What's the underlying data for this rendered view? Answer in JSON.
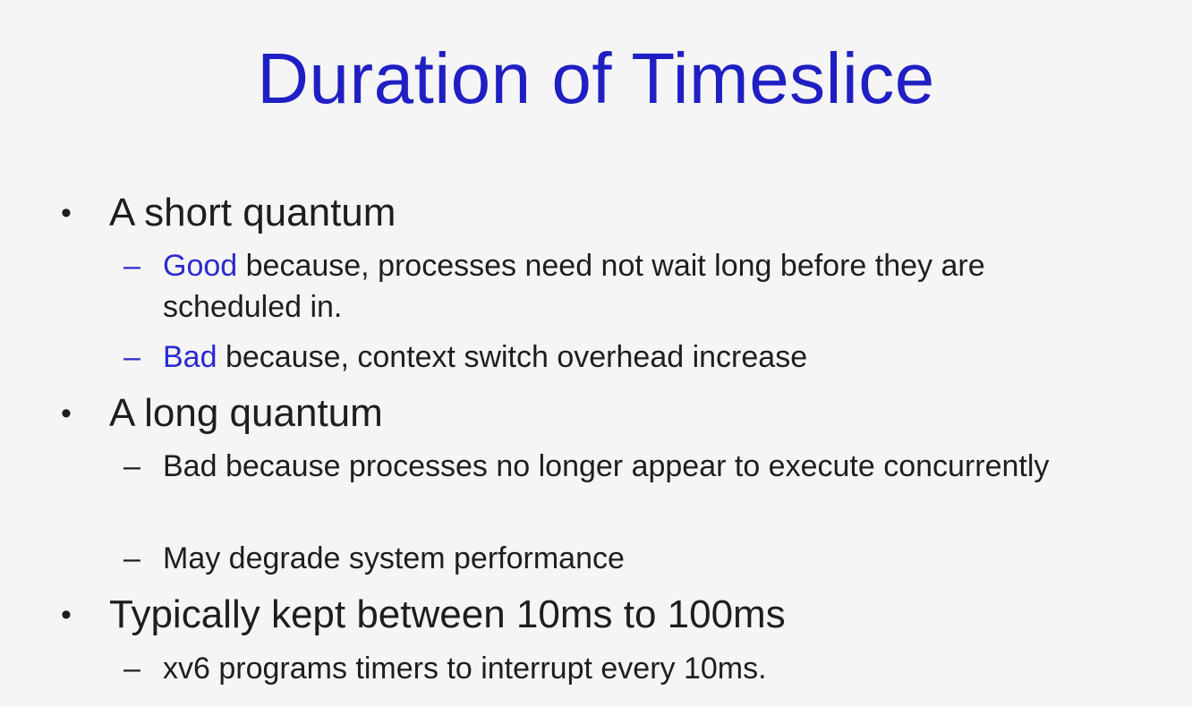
{
  "slide": {
    "title": "Duration of Timeslice",
    "bullet_glyph": "•",
    "dash_glyph": "–",
    "colors": {
      "title": "#1f1fc4",
      "emphasis": "#2a2ad0",
      "text": "#1e1e1e",
      "background": "#f5f5f5"
    },
    "points": [
      {
        "text": "A short quantum",
        "subpoints": [
          {
            "emphasis": "Good",
            "rest": " because, processes need not wait long before they are scheduled in."
          },
          {
            "emphasis": "Bad",
            "rest": " because, context switch overhead increase"
          }
        ]
      },
      {
        "text": "A long quantum",
        "subpoints": [
          {
            "text": "Bad because processes no longer appear to execute concurrently"
          },
          {
            "text": "May degrade system performance"
          }
        ]
      },
      {
        "text": "Typically kept between 10ms to 100ms",
        "subpoints": [
          {
            "text": "xv6 programs timers to interrupt every 10ms."
          }
        ]
      }
    ]
  }
}
